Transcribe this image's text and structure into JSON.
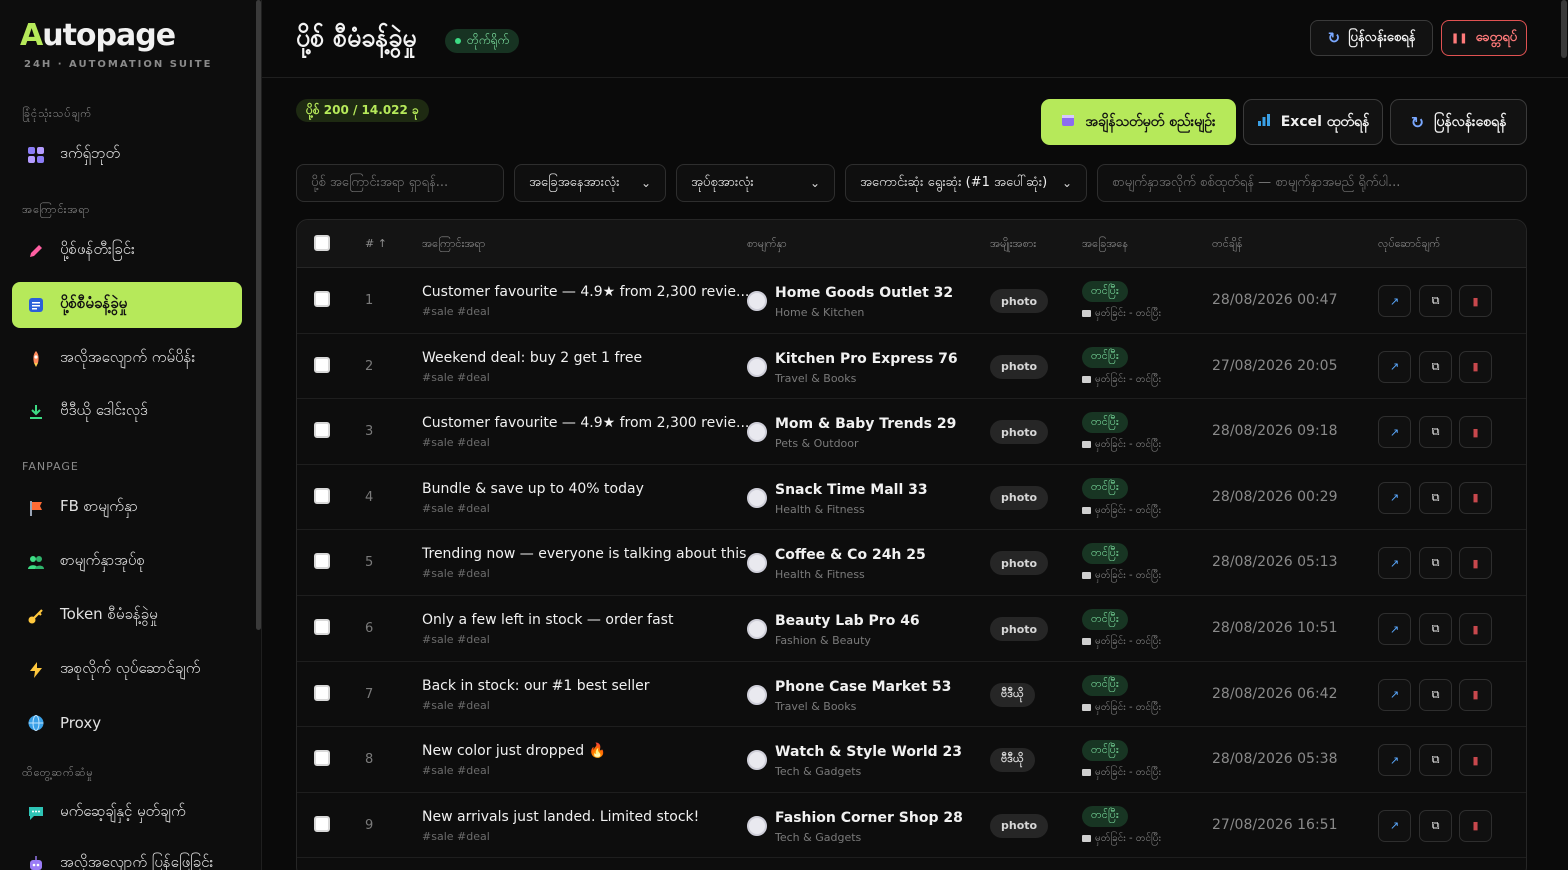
{
  "sidebar": {
    "logo_first": "A",
    "logo_rest": "utopage",
    "logo_sub": "24H · AUTOMATION SUITE",
    "sections": [
      {
        "title": "ခြုံငုံသုံးသပ်ချက်",
        "items": [
          {
            "label": "ဒက်ရှ်ဘုတ်",
            "icon": "grid-icon"
          }
        ]
      },
      {
        "title": "အကြောင်းအရာ",
        "items": [
          {
            "label": "ပို့စ်ဖန်တီးခြင်း",
            "icon": "pencil-icon"
          },
          {
            "label": "ပို့စ်စီမံခန့်ခွဲမှု",
            "icon": "document-icon",
            "active": true
          },
          {
            "label": "အလိုအလျောက် ကမ်ပိန်း",
            "icon": "rocket-icon"
          },
          {
            "label": "ဗီဒီယို ဒေါင်းလုဒ်",
            "icon": "download-icon"
          }
        ]
      },
      {
        "title": "FANPAGE",
        "items": [
          {
            "label": "FB စာမျက်နှာ",
            "icon": "flag-icon"
          },
          {
            "label": "စာမျက်နှာအုပ်စု",
            "icon": "users-icon"
          },
          {
            "label": "Token စီမံခန့်ခွဲမှု",
            "icon": "key-icon"
          },
          {
            "label": "အစုလိုက် လုပ်ဆောင်ချက်",
            "icon": "bolt-icon"
          },
          {
            "label": "Proxy",
            "icon": "globe-icon"
          }
        ]
      },
      {
        "title": "ထိတွေ့ဆက်ဆံမှု",
        "items": [
          {
            "label": "မက်ဆေ့ချ်နှင့် မှတ်ချက်",
            "icon": "chat-icon"
          },
          {
            "label": "အလိုအလျောက် ပြန်ဖြေခြင်း",
            "icon": "robot-icon"
          }
        ]
      }
    ]
  },
  "header": {
    "title": "ပို့စ် စီမံခန့်ခွဲမှု",
    "live_label": "တိုက်ရိုက်",
    "refresh_label": "ပြန်လန်းစေရန်",
    "stop_label": "ခေတ္တရပ်"
  },
  "toolbar": {
    "count": "ပို့စ် 200 / 14.022 ခု",
    "schedule_label": "အချိန်သတ်မှတ် စည်းမျဉ်း",
    "excel_label": "Excel ထုတ်ရန်",
    "refresh_label": "ပြန်လန်းစေရန်"
  },
  "filters": {
    "search_placeholder": "ပို့စ် အကြောင်းအရာ ရှာရန်...",
    "status_value": "အခြေအနေအားလုံး",
    "group_value": "အုပ်စုအားလုံး",
    "sort_value": "အကောင်းဆုံး ရွေးဆုံး (#1 အပေါ်ဆုံး)",
    "page_placeholder": "စာမျက်နှာအလိုက် စစ်ထုတ်ရန် — စာမျက်နှာအမည် ရိုက်ပါ..."
  },
  "table": {
    "columns": [
      "# ↑",
      "အကြောင်းအရာ",
      "စာမျက်နှာ",
      "အမျိုးအစား",
      "အခြေအနေ",
      "တင်ချိန်",
      "လုပ်ဆောင်ချက်"
    ],
    "rows": [
      {
        "n": "1",
        "content": "Customer favourite — 4.9★ from 2,300 revie...",
        "tags": "#sale #deal",
        "page": "Home Goods Outlet 32",
        "category": "Home & Kitchen",
        "type": "photo",
        "status": "တင်ပြီး",
        "sub": "မှတ်ခြင်း - တင်ပြီး",
        "time": "28/08/2026 00:47"
      },
      {
        "n": "2",
        "content": "Weekend deal: buy 2 get 1 free",
        "tags": "#sale #deal",
        "page": "Kitchen Pro Express 76",
        "category": "Travel & Books",
        "type": "photo",
        "status": "တင်ပြီး",
        "sub": "မှတ်ခြင်း - တင်ပြီး",
        "time": "27/08/2026 20:05"
      },
      {
        "n": "3",
        "content": "Customer favourite — 4.9★ from 2,300 revie...",
        "tags": "#sale #deal",
        "page": "Mom & Baby Trends 29",
        "category": "Pets & Outdoor",
        "type": "photo",
        "status": "တင်ပြီး",
        "sub": "မှတ်ခြင်း - တင်ပြီး",
        "time": "28/08/2026 09:18"
      },
      {
        "n": "4",
        "content": "Bundle & save up to 40% today",
        "tags": "#sale #deal",
        "page": "Snack Time Mall 33",
        "category": "Health & Fitness",
        "type": "photo",
        "status": "တင်ပြီး",
        "sub": "မှတ်ခြင်း - တင်ပြီး",
        "time": "28/08/2026 00:29"
      },
      {
        "n": "5",
        "content": "Trending now — everyone is talking about this",
        "tags": "#sale #deal",
        "page": "Coffee & Co 24h 25",
        "category": "Health & Fitness",
        "type": "photo",
        "status": "တင်ပြီး",
        "sub": "မှတ်ခြင်း - တင်ပြီး",
        "time": "28/08/2026 05:13"
      },
      {
        "n": "6",
        "content": "Only a few left in stock — order fast",
        "tags": "#sale #deal",
        "page": "Beauty Lab Pro 46",
        "category": "Fashion & Beauty",
        "type": "photo",
        "status": "တင်ပြီး",
        "sub": "မှတ်ခြင်း - တင်ပြီး",
        "time": "28/08/2026 10:51"
      },
      {
        "n": "7",
        "content": "Back in stock: our #1 best seller",
        "tags": "#sale #deal",
        "page": "Phone Case Market 53",
        "category": "Travel & Books",
        "type": "ဗီဒီယို",
        "status": "တင်ပြီး",
        "sub": "မှတ်ခြင်း - တင်ပြီး",
        "time": "28/08/2026 06:42"
      },
      {
        "n": "8",
        "content": "New color just dropped 🔥",
        "tags": "#sale #deal",
        "page": "Watch & Style World 23",
        "category": "Tech & Gadgets",
        "type": "ဗီဒီယို",
        "status": "တင်ပြီး",
        "sub": "မှတ်ခြင်း - တင်ပြီး",
        "time": "28/08/2026 05:38"
      },
      {
        "n": "9",
        "content": "New arrivals just landed. Limited stock!",
        "tags": "#sale #deal",
        "page": "Fashion Corner Shop 28",
        "category": "Tech & Gadgets",
        "type": "photo",
        "status": "တင်ပြီး",
        "sub": "မှတ်ခြင်း - တင်ပြီး",
        "time": "27/08/2026 16:51"
      }
    ]
  },
  "colors": {
    "accent": "#b6e95a",
    "status_green": "#7ee2a2",
    "stop_red": "#e05252"
  }
}
